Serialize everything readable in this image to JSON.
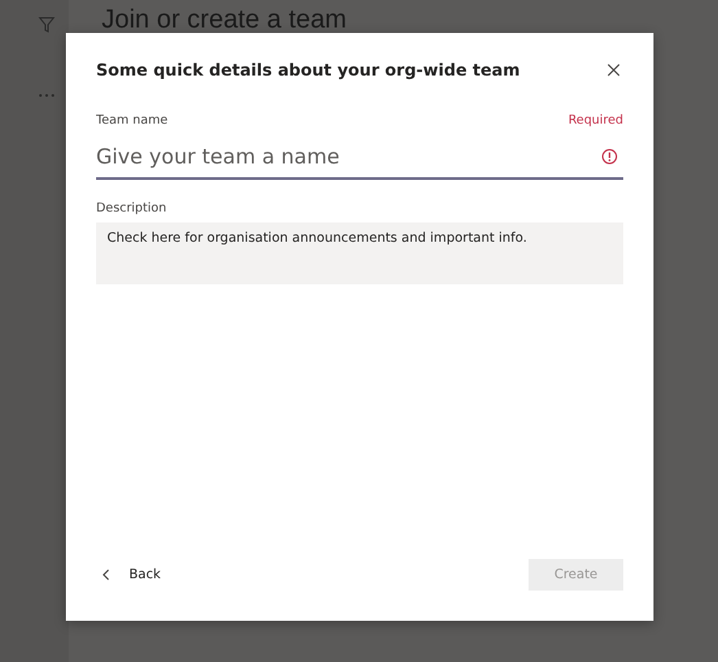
{
  "background": {
    "heading": "Join or create a team"
  },
  "dialog": {
    "title": "Some quick details about your org-wide team",
    "team_name": {
      "label": "Team name",
      "required": "Required",
      "placeholder": "Give your team a name",
      "error": true
    },
    "description": {
      "label": "Description",
      "value": "Check here for organisation announcements and important info."
    },
    "back_button": {
      "label": "Back"
    },
    "create_button": {
      "label": "Create",
      "disabled": true
    }
  }
}
